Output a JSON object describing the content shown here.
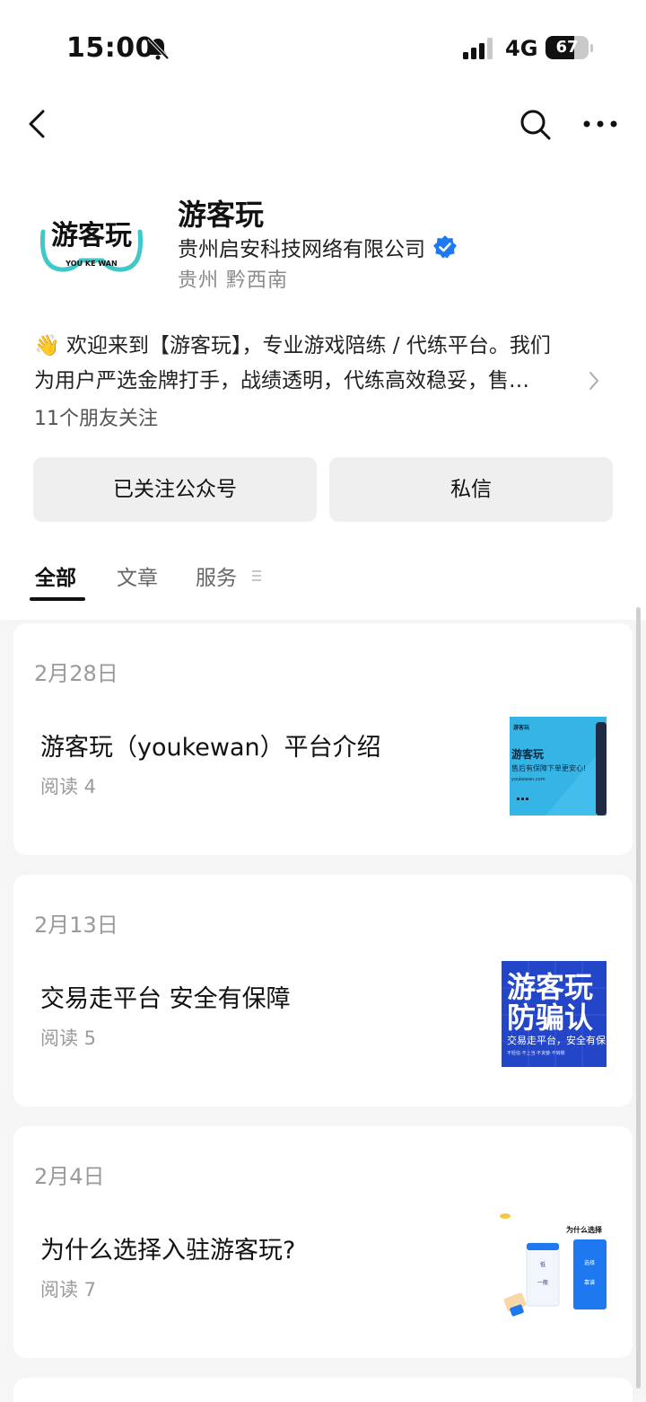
{
  "status_bar": {
    "time": "15:00",
    "network": "4G",
    "battery": "67",
    "battery_level": 0.67
  },
  "nav": {
    "back_icon": "chevron-left-icon",
    "search_icon": "search-icon",
    "more_icon": "more-dots-icon"
  },
  "profile": {
    "logo_text": "游客玩",
    "logo_subtext": "YOU KE WAN",
    "name": "游客玩",
    "company": "贵州启安科技网络有限公司",
    "verified_icon": "verified-badge-icon",
    "location": "贵州 黔西南",
    "intro_emoji": "👋",
    "intro_line1": "欢迎来到【游客玩】，专业游戏陪练 / 代练平台。我们",
    "intro_line2": "为用户严选金牌打手，战绩透明，代练高效稳妥，售…",
    "friends_following": "11个朋友关注"
  },
  "actions": {
    "follow_label": "已关注公众号",
    "message_label": "私信"
  },
  "tabs": [
    {
      "label": "全部",
      "active": true
    },
    {
      "label": "文章",
      "active": false
    },
    {
      "label": "服务",
      "active": false
    }
  ],
  "articles": [
    {
      "date": "2月28日",
      "title": "游客玩（youkewan）平台介绍",
      "reads": "阅读 4",
      "thumb": {
        "brand": "游客玩",
        "heading": "游客玩",
        "sub": "售后有保障下单更安心!",
        "url": "youkewan.com"
      }
    },
    {
      "date": "2月13日",
      "title": "交易走平台  安全有保障",
      "reads": "阅读 5",
      "thumb": {
        "line1": "游客玩",
        "line2": "防骗认",
        "sub": "交易走平台，安全有保",
        "small": "不轻信·不上当·不贪婪·不转账"
      }
    },
    {
      "date": "2月4日",
      "title": "为什么选择入驻游客玩?",
      "reads": "阅读 7",
      "thumb": {
        "heading": "为什么选择",
        "col1_top": "低",
        "col1_bottom": "一般",
        "col2_top": "选择",
        "col2_bottom": "靠谱"
      }
    }
  ],
  "colors": {
    "accent_blue": "#1e78f0",
    "logo_teal": "#3fc7c9",
    "text_gray": "#9a9a9a"
  }
}
